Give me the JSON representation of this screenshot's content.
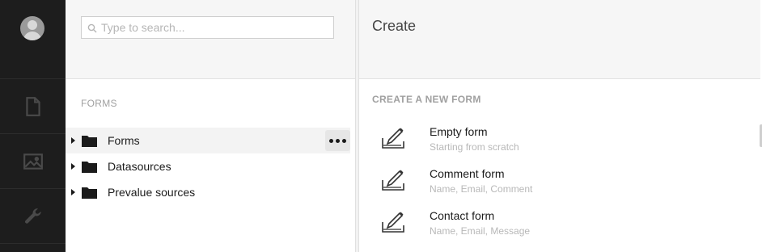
{
  "search": {
    "placeholder": "Type to search..."
  },
  "tree": {
    "section_title": "FORMS",
    "items": [
      {
        "label": "Forms"
      },
      {
        "label": "Datasources"
      },
      {
        "label": "Prevalue sources"
      }
    ]
  },
  "panel": {
    "title": "Create",
    "subtitle": "CREATE A NEW FORM",
    "options": [
      {
        "name": "Empty form",
        "description": "Starting from scratch"
      },
      {
        "name": "Comment form",
        "description": "Name, Email, Comment"
      },
      {
        "name": "Contact form",
        "description": "Name, Email, Message"
      }
    ]
  },
  "icons": {
    "rail": [
      "avatar",
      "content-icon",
      "media-icon",
      "settings-wrench-icon"
    ],
    "tree": [
      "caret-right-icon",
      "folder-icon",
      "more-actions-icon"
    ],
    "options": "form-edit-icon"
  },
  "colors": {
    "rail": "#1d1d1d",
    "header": "#f6f6f6",
    "muted_text": "#a0a0a0"
  }
}
